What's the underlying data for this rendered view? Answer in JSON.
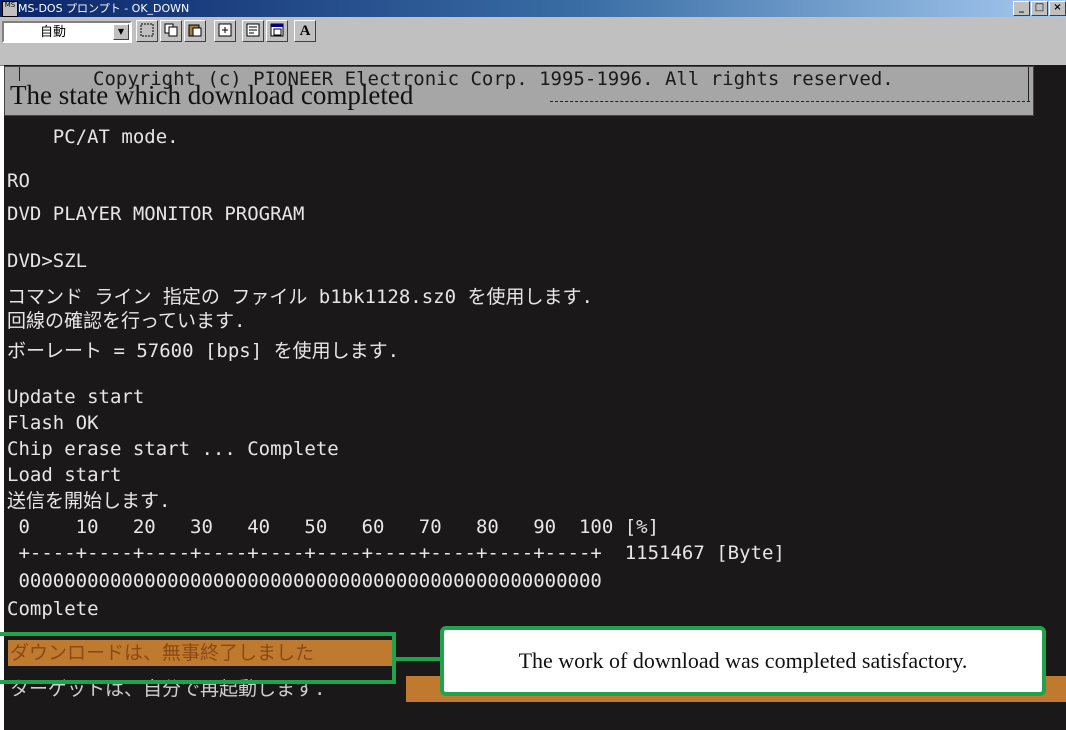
{
  "window": {
    "title": "MS-DOS プロンプト - OK_DOWN",
    "icon_text": "MS",
    "minimize": "_",
    "maximize": "□",
    "close": "×"
  },
  "toolbar": {
    "font_size_value": "自動",
    "font_button": "A"
  },
  "banner": {
    "copyright": "Copyright (c) PIONEER Electronic Corp. 1995-1996. All rights reserved.",
    "overlay_title": "The state which download completed"
  },
  "console": {
    "lines": [
      "    PC/AT mode.",
      "",
      "RO",
      "DVD PLAYER MONITOR PROGRAM",
      "",
      "DVD>SZL",
      "コマンド ライン 指定の ファイル b1bk1128.sz0 を使用します.",
      "回線の確認を行っています.",
      "ボーレート = 57600 [bps] を使用します.",
      "",
      "Update start",
      "Flash OK",
      "Chip erase start ... Complete",
      "Load start",
      "送信を開始します.",
      " 0    10   20   30   40   50   60   70   80   90  100 [%]",
      " +----+----+----+----+----+----+----+----+----+----+  1151467 [Byte]",
      " 000000000000000000000000000000000000000000000000000",
      "Complete"
    ],
    "final_line_1": "ダウンロードは、無事終了しました",
    "final_line_2": "ターゲットは、自分で再起動します."
  },
  "callout": {
    "text": "The work of download was completed satisfactory."
  },
  "colors": {
    "console_bg": "#1a1818",
    "console_text": "#e6e6e6",
    "highlight_orange": "#c07a30",
    "callout_green": "#21a34e",
    "titlebar": "#0a246a"
  }
}
